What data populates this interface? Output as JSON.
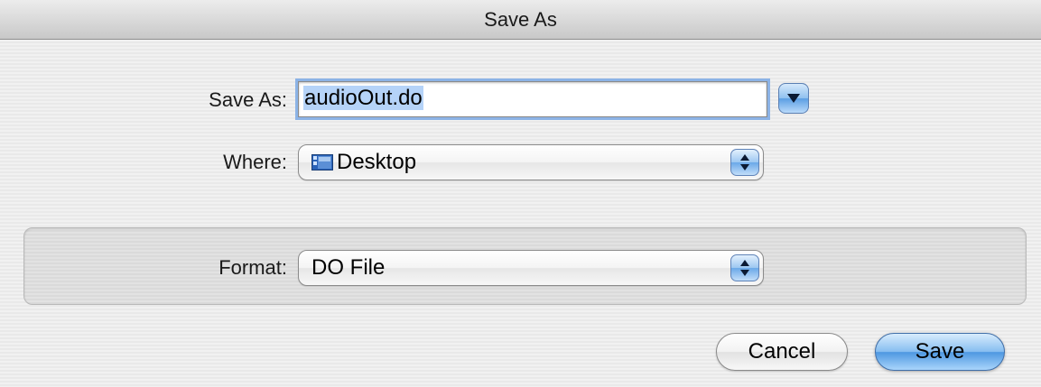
{
  "window": {
    "title": "Save As"
  },
  "form": {
    "save_as_label": "Save As:",
    "filename_value": "audioOut.do",
    "where_label": "Where:",
    "where_value": "Desktop",
    "where_icon": "desktop-folder-icon",
    "format_label": "Format:",
    "format_value": "DO File"
  },
  "buttons": {
    "cancel_label": "Cancel",
    "save_label": "Save"
  },
  "colors": {
    "accent": "#5b9ee3",
    "selection": "#b5d3f8",
    "focus_ring": "#8cb3e6"
  }
}
